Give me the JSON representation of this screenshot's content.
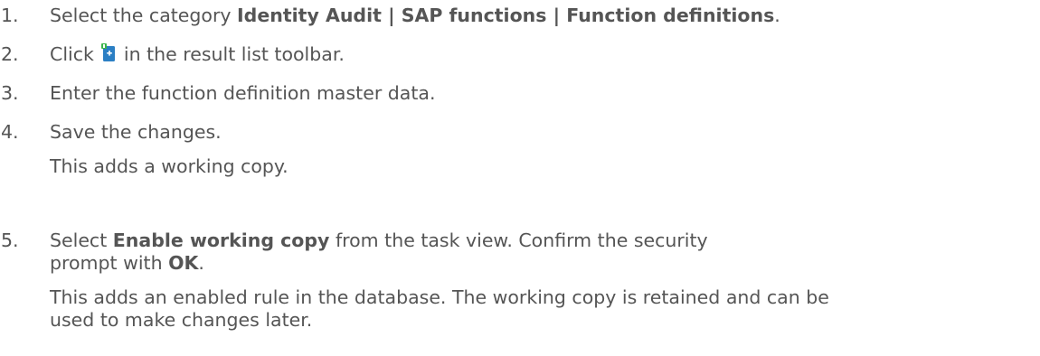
{
  "steps": [
    {
      "number": "1.",
      "prefix": "Select the category ",
      "bold": "Identity Audit | SAP functions | Function definitions",
      "suffix": "."
    },
    {
      "number": "2.",
      "prefix": "Click",
      "icon": "add-new-icon",
      "suffix": "in the result list toolbar."
    },
    {
      "number": "3.",
      "text": "Enter the function definition master data."
    },
    {
      "number": "4.",
      "text": "Save the changes.",
      "note": "This adds a working copy."
    },
    {
      "number": "5.",
      "prefix": "Select ",
      "bold": "Enable working copy",
      "middle": " from the task view. Confirm the security",
      "line2_prefix": "prompt with ",
      "bold2": "OK",
      "suffix": ".",
      "note_line1": "This adds an enabled rule in the database. The working copy is retained and can be",
      "note_line2": "used to make changes later."
    }
  ],
  "colors": {
    "text": "#555555",
    "icon_body": "#2b7fc4",
    "icon_accent": "#3bb54a"
  }
}
